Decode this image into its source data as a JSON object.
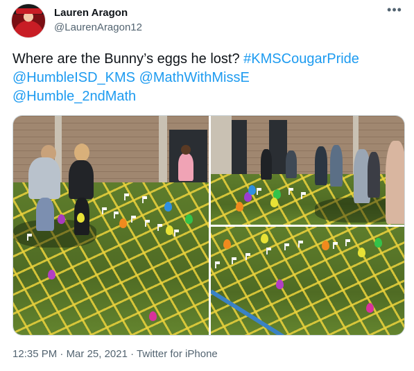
{
  "author": {
    "name": "Lauren Aragon",
    "handle": "@LaurenAragon12",
    "avatar_icon": "profile-photo"
  },
  "more_icon": "more-options-icon",
  "tweet": {
    "text_plain": "Where are the Bunny’s eggs he lost?",
    "hashtag": "#KMSCougarPride",
    "mention1": "@HumbleISD_KMS",
    "mention2": "@MathWithMissE",
    "mention3": "@Humble_2ndMath"
  },
  "meta": {
    "time": "12:35 PM",
    "date": "Mar 25, 2021",
    "source": "Twitter for iPhone",
    "separator": "·"
  },
  "colors": {
    "link": "#1d9bf0",
    "text": "#0f1419",
    "secondary": "#536471"
  }
}
